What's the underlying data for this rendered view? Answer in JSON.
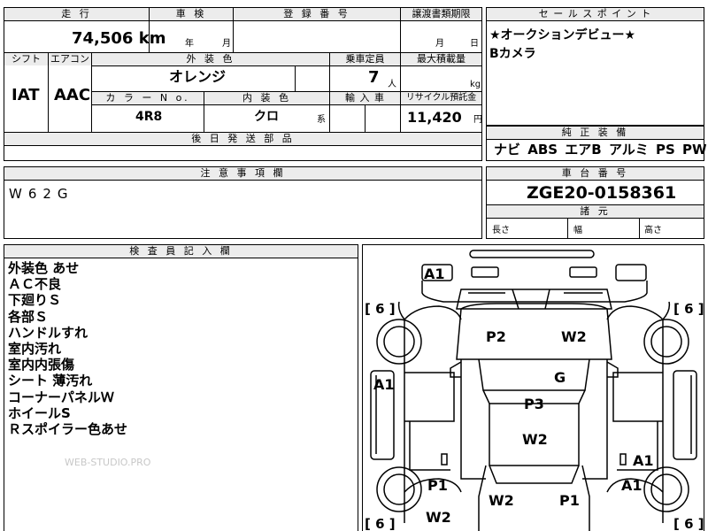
{
  "headers": {
    "mileage": "走 行",
    "inspection": "車 検",
    "registration_no": "登 録 番 号",
    "transfer_deadline": "譲渡書類期限",
    "shift": "シフト",
    "aircon": "エアコン",
    "exterior_color": "外 装 色",
    "capacity": "乗車定員",
    "max_load": "最大積載量",
    "color_no": "カ ラ ー N o.",
    "interior_color": "内 装 色",
    "import": "輸 入 車",
    "recycle": "リサイクル預託金",
    "parts_later": "後 日 発 送 部 品",
    "sales_point": "セ ー ル ス ポ イ ン ト",
    "genuine_equipment": "純 正 装 備",
    "caution": "注 意 事 項 欄",
    "chassis_no": "車 台 番 号",
    "specs": "諸 元",
    "inspector_notes": "検 査 員 記 入 欄"
  },
  "mileage": {
    "value": "74,506",
    "unit": "km"
  },
  "inspection": {
    "year_label": "年",
    "month_label": "月"
  },
  "transfer_deadline": {
    "month_label": "月",
    "day_label": "日"
  },
  "shift": "IAT",
  "aircon": "AAC",
  "exterior_color": "オレンジ",
  "capacity": {
    "value": "7",
    "unit": "人"
  },
  "max_load": {
    "unit": "kg"
  },
  "color_no": "4R8",
  "interior_color": {
    "value": "クロ",
    "suffix": "系"
  },
  "recycle": {
    "value": "11,420",
    "unit": "円"
  },
  "sales_points": [
    "★オークションデビュー★",
    "Bカメラ"
  ],
  "genuine_equipment": "ナビ ABS エアB アルミ PS PW",
  "caution": "W62G",
  "chassis_no": "ZGE20-0158361",
  "specs": {
    "length": "長さ",
    "width": "幅",
    "height": "高さ"
  },
  "inspector_notes": [
    "外装色 あせ",
    "ＡＣ不良",
    "下廻りＳ",
    "各部Ｓ",
    "ハンドルすれ",
    "室内汚れ",
    "室内内張傷",
    "シート 薄汚れ",
    "コーナーパネルＷ",
    "ホイールS",
    "Ｒスポイラー色あせ"
  ],
  "watermark": "WEB-STUDIO.PRO",
  "diagram": {
    "marks": {
      "a1_top": "A1",
      "p2": "P2",
      "w2_roof": "W2",
      "g": "G",
      "a1_left": "A1",
      "p3": "P3",
      "w2_center": "W2",
      "a1_right_lower": "A1",
      "p1_left": "P1",
      "a1_right": "A1",
      "w2_rear": "W2",
      "p1_rear": "P1",
      "w2_bottom": "W2"
    },
    "tires": {
      "tl": "[ 6 ]",
      "tr": "[ 6 ]",
      "bl": "[ 6 ]",
      "br": "[ 6 ]"
    }
  }
}
